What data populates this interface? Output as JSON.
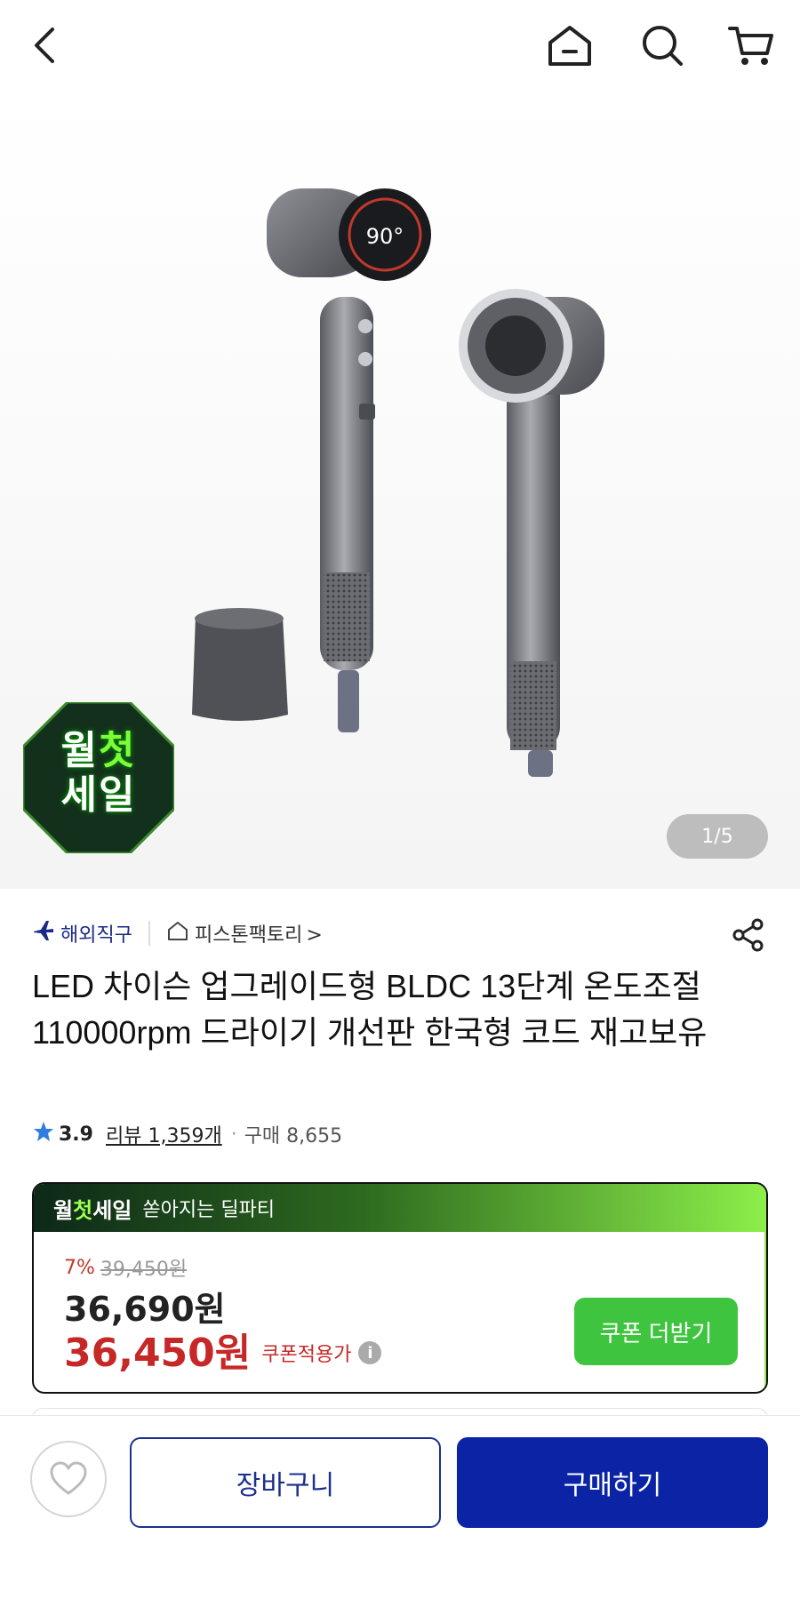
{
  "topbar": {
    "icons": [
      "back-chevron-icon",
      "home-icon",
      "search-icon",
      "cart-icon"
    ]
  },
  "gallery": {
    "pager": "1/5",
    "badge_line1_a": "월",
    "badge_line1_b": "첫",
    "badge_line2": "세일"
  },
  "meta": {
    "overseas_label": "해외직구",
    "seller_name": "피스톤팩토리",
    "seller_chevron": ">"
  },
  "product": {
    "title": "LED 차이슨 업그레이드형 BLDC 13단계 온도조절 110000rpm 드라이기 개선판 한국형 코드 재고보유"
  },
  "rating": {
    "score": "3.9",
    "reviews": "리뷰 1,359개",
    "dot": "·",
    "sold": "구매 8,655"
  },
  "deal": {
    "brand_a": "월",
    "brand_b": "첫",
    "brand_c": "세일",
    "subtitle": "쏟아지는 딜파티",
    "discount_pct": "7%",
    "original_price": "39,450원",
    "price": "36,690원",
    "coupon_price": "36,450원",
    "coupon_label": "쿠폰적용가",
    "info_glyph": "i",
    "coupon_button": "쿠폰 더받기"
  },
  "bottom": {
    "cart_button": "장바구니",
    "buy_button": "구매하기"
  },
  "colors": {
    "primary_blue": "#0b24a5",
    "sale_red": "#c62828",
    "coupon_green": "#3fc43f"
  }
}
